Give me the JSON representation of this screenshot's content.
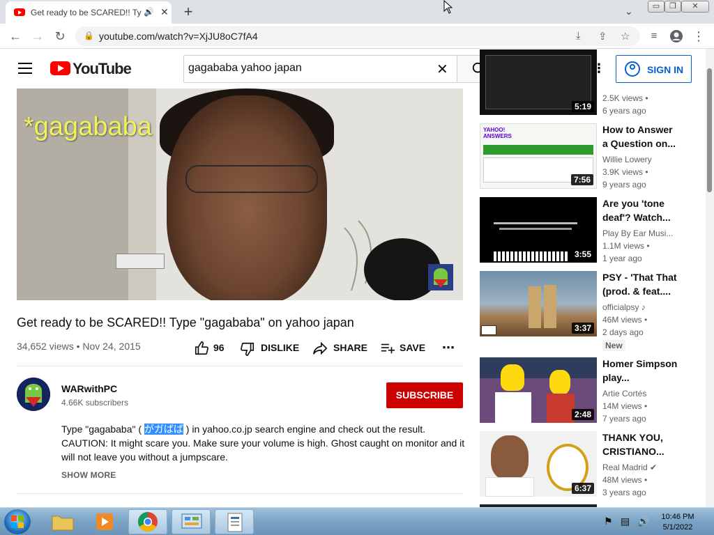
{
  "browser": {
    "tab_title": "Get ready to be SCARED!! Ty",
    "url": "youtube.com/watch?v=XjJU8oC7fA4"
  },
  "youtube": {
    "logo_text": "YouTube",
    "search_value": "gagababa yahoo japan",
    "signin_label": "SIGN IN"
  },
  "video": {
    "overlay_caption": "*gagababa",
    "title": "Get ready to be SCARED!! Type \"gagababa\" on yahoo japan",
    "views_date": "34,652 views • Nov 24, 2015",
    "likes": "96",
    "dislike_label": "DISLIKE",
    "share_label": "SHARE",
    "save_label": "SAVE"
  },
  "channel": {
    "name": "WARwithPC",
    "subscribers": "4.66K subscribers",
    "subscribe_label": "SUBSCRIBE"
  },
  "description": {
    "line1_pre": "Type \"gagababa\" ( ",
    "line1_selected": "がガばば",
    "line1_post": " ) in yahoo.co.jp search engine and check out the result.",
    "line2": "CAUTION: It might scare you. Make sure your volume is high. Ghost caught on monitor and it will not leave you without a jumpscare.",
    "show_more": "SHOW MORE"
  },
  "recommendations": [
    {
      "title": "",
      "channel": "",
      "views": "2.5K views •",
      "age": "6 years ago",
      "duration": "5:19"
    },
    {
      "title": "How to Answer a Question on...",
      "channel": "Willie Lowery",
      "views": "3.9K views •",
      "age": "9 years ago",
      "duration": "7:56"
    },
    {
      "title": "Are you 'tone deaf'? Watch...",
      "channel": "Play By Ear Musi...",
      "views": "1.1M views •",
      "age": "1 year ago",
      "duration": "3:55"
    },
    {
      "title": "PSY - 'That That (prod. & feat....",
      "channel": "officialpsy ♪",
      "views": "46M views •",
      "age": "2 days ago",
      "badge": "New",
      "duration": "3:37"
    },
    {
      "title": "Homer Simpson play...",
      "channel": "Artie Cortés",
      "views": "14M views •",
      "age": "7 years ago",
      "duration": "2:48"
    },
    {
      "title": "THANK YOU, CRISTIANO...",
      "channel": "Real Madrid ✔",
      "views": "48M views •",
      "age": "3 years ago",
      "duration": "6:37"
    }
  ],
  "taskbar": {
    "time": "10:46 PM",
    "date": "5/1/2022"
  },
  "colors": {
    "yt_red": "#ff0000",
    "subscribe_red": "#cc0000",
    "link_blue": "#065fd4",
    "selection_blue": "#3390ff"
  }
}
